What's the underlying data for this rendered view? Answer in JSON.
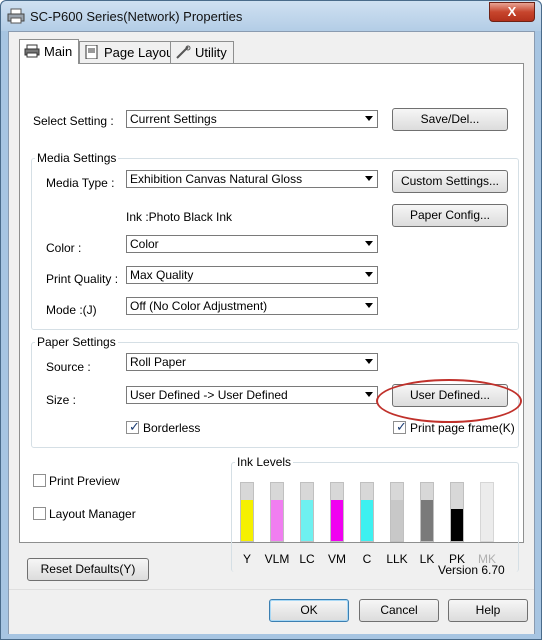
{
  "window": {
    "title": "SC-P600 Series(Network) Properties",
    "close_label": "X"
  },
  "tabs": [
    {
      "label": "Main",
      "icon": "printer-icon"
    },
    {
      "label": "Page Layout",
      "icon": "page-layout-icon"
    },
    {
      "label": "Utility",
      "icon": "utility-icon"
    }
  ],
  "select_setting": {
    "label": "Select Setting :",
    "value": "Current Settings",
    "button": "Save/Del..."
  },
  "media_settings": {
    "title": "Media Settings",
    "media_type_label": "Media Type :",
    "media_type_value": "Exhibition Canvas Natural Gloss",
    "custom_settings_button": "Custom Settings...",
    "ink_text": "Ink :Photo Black Ink",
    "paper_config_button": "Paper Config...",
    "color_label": "Color :",
    "color_value": "Color",
    "quality_label": "Print Quality :",
    "quality_value": "Max Quality",
    "mode_label": "Mode :(J)",
    "mode_value": "Off (No Color Adjustment)"
  },
  "paper_settings": {
    "title": "Paper Settings",
    "source_label": "Source :",
    "source_value": "Roll Paper",
    "size_label": "Size :",
    "size_value": "User Defined -> User Defined",
    "user_defined_button": "User Defined...",
    "borderless_label": "Borderless",
    "borderless_checked": true,
    "print_page_frame_label": "Print page frame(K)",
    "print_page_frame_checked": true
  },
  "options": {
    "print_preview_label": "Print Preview",
    "print_preview_checked": false,
    "layout_manager_label": "Layout Manager",
    "layout_manager_checked": false
  },
  "ink_levels": {
    "title": "Ink Levels",
    "inks": [
      {
        "label": "Y",
        "color": "#f5f000",
        "level": 0.7
      },
      {
        "label": "VLM",
        "color": "#f07ef0",
        "level": 0.7
      },
      {
        "label": "LC",
        "color": "#6ef0f0",
        "level": 0.7
      },
      {
        "label": "VM",
        "color": "#f000f0",
        "level": 0.7
      },
      {
        "label": "C",
        "color": "#3ef0f0",
        "level": 0.7
      },
      {
        "label": "LLK",
        "color": "#c8c8c8",
        "level": 0.7
      },
      {
        "label": "LK",
        "color": "#7a7a7a",
        "level": 0.7
      },
      {
        "label": "PK",
        "color": "#000000",
        "level": 0.55
      },
      {
        "label": "MK",
        "color": "#ececec",
        "level": 0.0,
        "disabled": true
      }
    ]
  },
  "footer": {
    "reset_button": "Reset Defaults(Y)",
    "version_text": "Version 6.70",
    "ok_button": "OK",
    "cancel_button": "Cancel",
    "help_button": "Help"
  }
}
